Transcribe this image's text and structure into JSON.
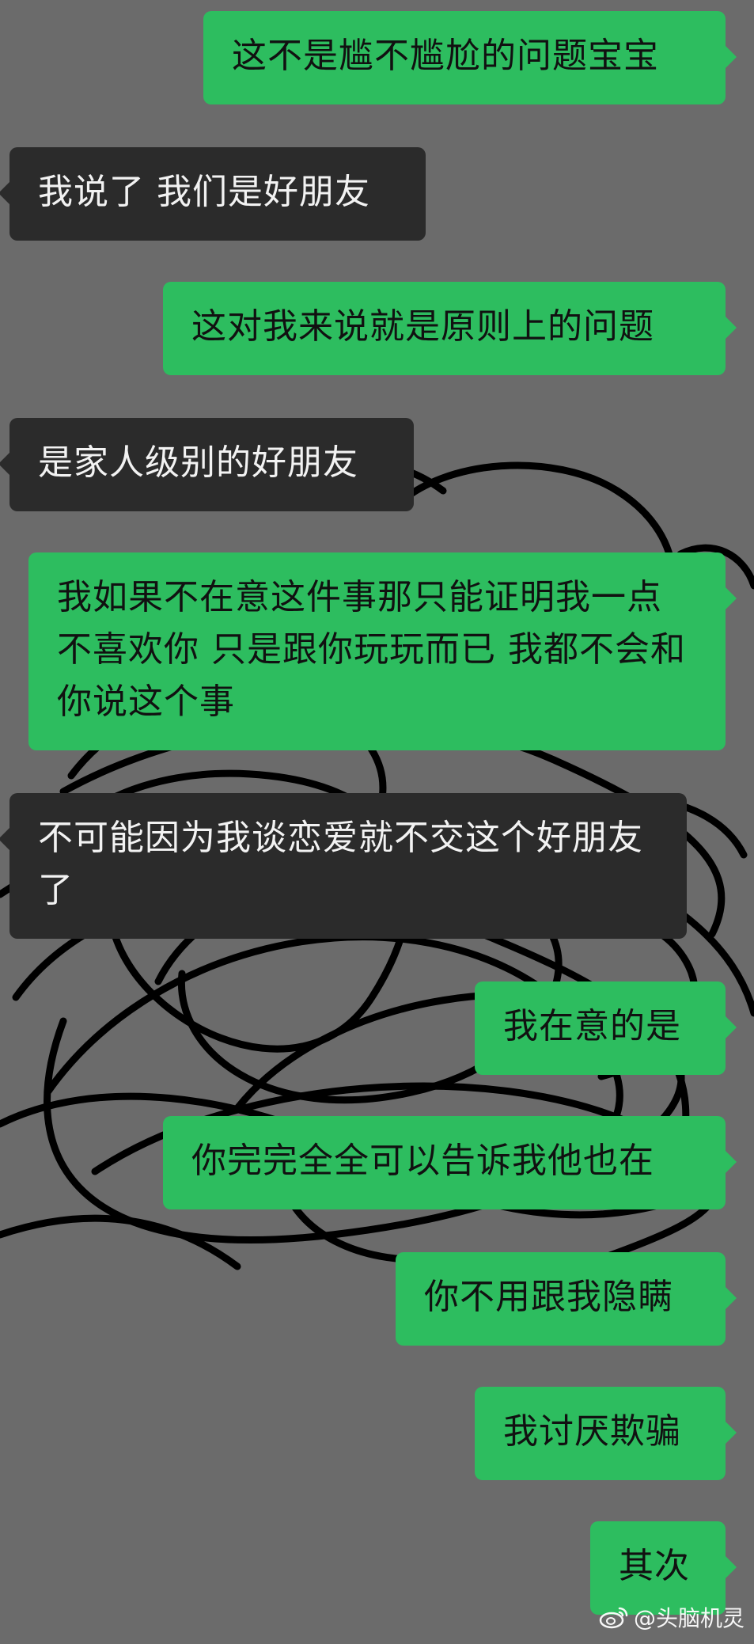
{
  "messages": [
    {
      "side": "out",
      "text": "这不是尴不尴尬的问题宝宝"
    },
    {
      "side": "in",
      "text": "我说了 我们是好朋友"
    },
    {
      "side": "out",
      "text": "这对我来说就是原则上的问题"
    },
    {
      "side": "in",
      "text": "是家人级别的好朋友"
    },
    {
      "side": "out",
      "text": "我如果不在意这件事那只能证明我一点不喜欢你 只是跟你玩玩而已 我都不会和你说这个事"
    },
    {
      "side": "in",
      "text": "不可能因为我谈恋爱就不交这个好朋友了"
    },
    {
      "side": "out",
      "text": "我在意的是"
    },
    {
      "side": "out",
      "text": "你完完全全可以告诉我他也在"
    },
    {
      "side": "out",
      "text": "你不用跟我隐瞒"
    },
    {
      "side": "out",
      "text": "我讨厌欺骗"
    },
    {
      "side": "out",
      "text": "其次"
    }
  ],
  "watermark": {
    "icon": "weibo-icon",
    "text": "@头脑机灵"
  },
  "colors": {
    "background": "#6b6b6b",
    "outgoing_bubble": "#2dbd5f",
    "incoming_bubble": "#2b2b2b",
    "scribble": "#000000"
  }
}
